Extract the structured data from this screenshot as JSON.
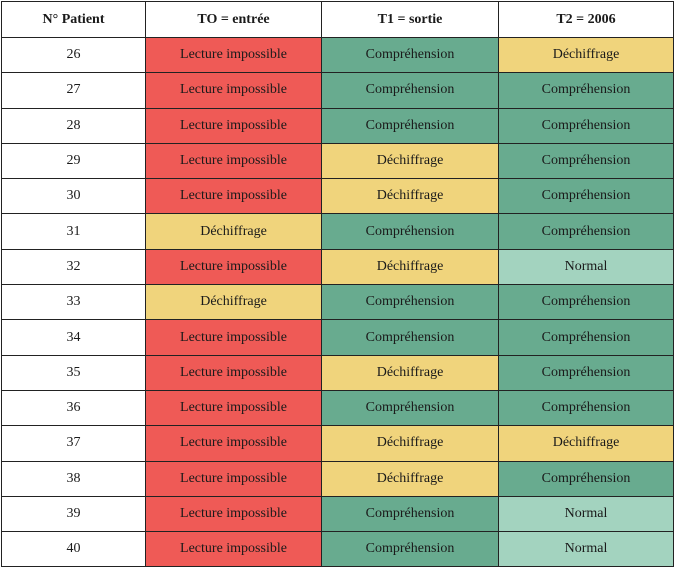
{
  "table": {
    "headers": [
      "N° Patient",
      "TO = entrée",
      "T1 = sortie",
      "T2 = 2006"
    ],
    "status_colors": {
      "Lecture impossible": "#ef5a56",
      "Compréhension": "#68ab8f",
      "Déchiffrage": "#f0d47c",
      "Normal": "#a3d3bf"
    },
    "rows": [
      {
        "patient": "26",
        "t0": "Lecture impossible",
        "t1": "Compréhension",
        "t2": "Déchiffrage"
      },
      {
        "patient": "27",
        "t0": "Lecture impossible",
        "t1": "Compréhension",
        "t2": "Compréhension"
      },
      {
        "patient": "28",
        "t0": "Lecture impossible",
        "t1": "Compréhension",
        "t2": "Compréhension"
      },
      {
        "patient": "29",
        "t0": "Lecture impossible",
        "t1": "Déchiffrage",
        "t2": "Compréhension"
      },
      {
        "patient": "30",
        "t0": "Lecture impossible",
        "t1": "Déchiffrage",
        "t2": "Compréhension"
      },
      {
        "patient": "31",
        "t0": "Déchiffrage",
        "t1": "Compréhension",
        "t2": "Compréhension"
      },
      {
        "patient": "32",
        "t0": "Lecture impossible",
        "t1": "Déchiffrage",
        "t2": "Normal"
      },
      {
        "patient": "33",
        "t0": "Déchiffrage",
        "t1": "Compréhension",
        "t2": "Compréhension"
      },
      {
        "patient": "34",
        "t0": "Lecture impossible",
        "t1": "Compréhension",
        "t2": "Compréhension"
      },
      {
        "patient": "35",
        "t0": "Lecture impossible",
        "t1": "Déchiffrage",
        "t2": "Compréhension"
      },
      {
        "patient": "36",
        "t0": "Lecture impossible",
        "t1": "Compréhension",
        "t2": "Compréhension"
      },
      {
        "patient": "37",
        "t0": "Lecture impossible",
        "t1": "Déchiffrage",
        "t2": "Déchiffrage"
      },
      {
        "patient": "38",
        "t0": "Lecture impossible",
        "t1": "Déchiffrage",
        "t2": "Compréhension"
      },
      {
        "patient": "39",
        "t0": "Lecture impossible",
        "t1": "Compréhension",
        "t2": "Normal"
      },
      {
        "patient": "40",
        "t0": "Lecture impossible",
        "t1": "Compréhension",
        "t2": "Normal"
      }
    ]
  }
}
